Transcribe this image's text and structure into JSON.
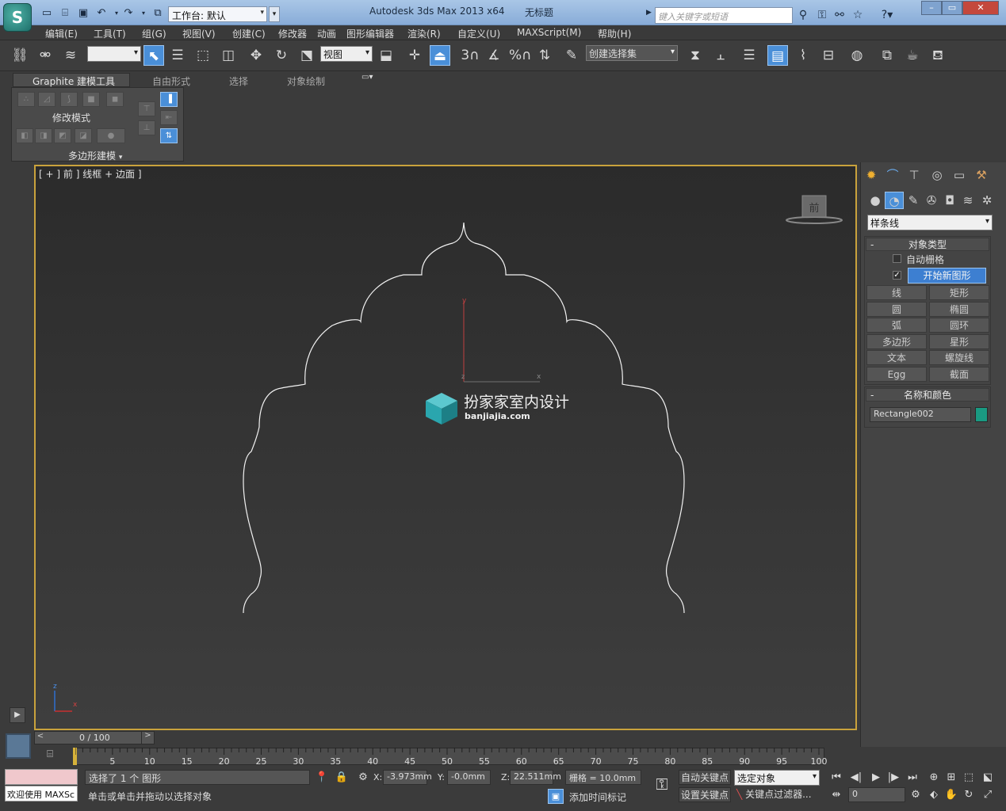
{
  "app": {
    "title": "Autodesk 3ds Max  2013 x64",
    "document": "无标题",
    "workspace_label": "工作台: 默认",
    "search_placeholder": "键入关键字或短语"
  },
  "menu": [
    "编辑(E)",
    "工具(T)",
    "组(G)",
    "视图(V)",
    "创建(C)",
    "修改器",
    "动画",
    "图形编辑器",
    "渲染(R)",
    "自定义(U)",
    "MAXScript(M)",
    "帮助(H)"
  ],
  "toolbar": {
    "ref_coord": "视图",
    "selection_set": "创建选择集",
    "snap_labels": [
      "3",
      "%"
    ]
  },
  "ribbon": {
    "tabs": [
      "Graphite 建模工具",
      "自由形式",
      "选择",
      "对象绘制"
    ],
    "modify_mode": "修改模式",
    "poly_modeling": "多边形建模"
  },
  "viewport": {
    "label": "[ + ] 前 ] 线框 + 边面 ]",
    "label_parts": [
      "[",
      "+",
      "]",
      "前",
      "]",
      "线框",
      "+",
      "边面",
      "]"
    ],
    "viewcube_label": "前",
    "watermark_title": "扮家家室内设计",
    "watermark_url": "banjiajia.com",
    "axis_y": "y",
    "axis_x": "x",
    "axis_z": "z"
  },
  "command_panel": {
    "category": "样条线",
    "object_type_header": "对象类型",
    "autogrid": "自动栅格",
    "start_new_shape": "开始新图形",
    "start_new_shape_checked": true,
    "buttons": [
      "线",
      "矩形",
      "圆",
      "椭圆",
      "弧",
      "圆环",
      "多边形",
      "星形",
      "文本",
      "螺旋线",
      "Egg",
      "截面"
    ],
    "name_color_header": "名称和颜色",
    "object_name": "Rectangle002",
    "object_color": "#1a9a82",
    "collapse_mark": "-"
  },
  "timeline": {
    "frame_display": "0 / 100",
    "ticks": [
      "5",
      "10",
      "15",
      "20",
      "25",
      "30",
      "35",
      "40",
      "45",
      "50",
      "55",
      "60",
      "65",
      "70",
      "75",
      "80",
      "85",
      "90",
      "95",
      "100"
    ]
  },
  "status": {
    "welcome": "欢迎使用  MAXSc",
    "selected": "选择了 1 个 图形",
    "prompt": "单击或单击并拖动以选择对象",
    "x_label": "X:",
    "x_value": "-3.973mm",
    "y_label": "Y:",
    "y_value": "-0.0mm",
    "z_label": "Z:",
    "z_value": "22.511mm",
    "grid": "栅格 = 10.0mm",
    "auto_key": "自动关键点",
    "set_key": "设置关键点",
    "key_mode": "选定对象",
    "key_filters": "关键点过滤器...",
    "add_time_tag": "添加时间标记",
    "frame_value": "0"
  },
  "colors": {
    "viewport_border": "#c9a23c",
    "active_blue": "#4a8fd8"
  }
}
